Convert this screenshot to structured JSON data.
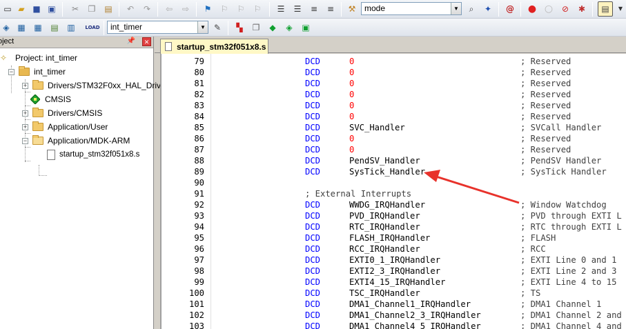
{
  "toolbar_top": {
    "icons": [
      "new-file-icon",
      "open-folder-icon",
      "save-icon",
      "save-all-icon",
      "cut-icon",
      "copy-icon",
      "paste-icon",
      "undo-icon",
      "redo-icon",
      "nav-back-icon",
      "nav-forward-icon",
      "bookmark-icon",
      "prev-bookmark-icon",
      "next-bookmark-icon",
      "clear-bookmarks-icon",
      "indent-icon",
      "unindent-icon",
      "comment-icon",
      "uncomment-icon",
      "find-in-files-icon"
    ],
    "find_combo_value": "mode",
    "icons_right": [
      "find-icon",
      "incremental-find-icon",
      "debug-session-icon",
      "breakpoint-icon",
      "disable-breakpoint-icon",
      "kill-breakpoints-icon",
      "kill-all-icon",
      "window-layout-icon"
    ]
  },
  "toolbar_second": {
    "icons": [
      "translate-icon",
      "build-icon",
      "rebuild-icon",
      "batch-build-icon",
      "download-icon"
    ],
    "load_label": "LOAD",
    "target_combo_value": "int_timer",
    "icons_right": [
      "target-options-icon",
      "manage-components-icon",
      "file-extensions-icon",
      "select-packs-icon",
      "pack-installer-icon",
      "runtime-env-icon"
    ]
  },
  "project_panel": {
    "title": "oject",
    "tree": [
      {
        "label": "Project: int_timer"
      },
      {
        "label": "int_timer"
      },
      {
        "label": "Drivers/STM32F0xx_HAL_Driv"
      },
      {
        "label": "CMSIS"
      },
      {
        "label": "Drivers/CMSIS"
      },
      {
        "label": "Application/User"
      },
      {
        "label": "Application/MDK-ARM"
      },
      {
        "label": "startup_stm32f051x8.s"
      }
    ]
  },
  "editor": {
    "active_tab": "startup_stm32f051x8.s",
    "lines": [
      {
        "n": "79",
        "kw": "DCD",
        "arg": "0",
        "num": true,
        "cmt": "; Reserved"
      },
      {
        "n": "80",
        "kw": "DCD",
        "arg": "0",
        "num": true,
        "cmt": "; Reserved"
      },
      {
        "n": "81",
        "kw": "DCD",
        "arg": "0",
        "num": true,
        "cmt": "; Reserved"
      },
      {
        "n": "82",
        "kw": "DCD",
        "arg": "0",
        "num": true,
        "cmt": "; Reserved"
      },
      {
        "n": "83",
        "kw": "DCD",
        "arg": "0",
        "num": true,
        "cmt": "; Reserved"
      },
      {
        "n": "84",
        "kw": "DCD",
        "arg": "0",
        "num": true,
        "cmt": "; Reserved"
      },
      {
        "n": "85",
        "kw": "DCD",
        "arg": "SVC_Handler",
        "num": false,
        "cmt": "; SVCall Handler"
      },
      {
        "n": "86",
        "kw": "DCD",
        "arg": "0",
        "num": true,
        "cmt": "; Reserved"
      },
      {
        "n": "87",
        "kw": "DCD",
        "arg": "0",
        "num": true,
        "cmt": "; Reserved"
      },
      {
        "n": "88",
        "kw": "DCD",
        "arg": "PendSV_Handler",
        "num": false,
        "cmt": "; PendSV Handler"
      },
      {
        "n": "89",
        "kw": "DCD",
        "arg": "SysTick_Handler",
        "num": false,
        "cmt": "; SysTick Handler"
      },
      {
        "n": "90",
        "kw": "",
        "arg": "",
        "num": false,
        "cmt": ""
      },
      {
        "n": "91",
        "full_comment": "; External Interrupts"
      },
      {
        "n": "92",
        "kw": "DCD",
        "arg": "WWDG_IRQHandler",
        "num": false,
        "cmt": "; Window Watchdog"
      },
      {
        "n": "93",
        "kw": "DCD",
        "arg": "PVD_IRQHandler",
        "num": false,
        "cmt": "; PVD through EXTI L"
      },
      {
        "n": "94",
        "kw": "DCD",
        "arg": "RTC_IRQHandler",
        "num": false,
        "cmt": "; RTC through EXTI L"
      },
      {
        "n": "95",
        "kw": "DCD",
        "arg": "FLASH_IRQHandler",
        "num": false,
        "cmt": "; FLASH"
      },
      {
        "n": "96",
        "kw": "DCD",
        "arg": "RCC_IRQHandler",
        "num": false,
        "cmt": "; RCC"
      },
      {
        "n": "97",
        "kw": "DCD",
        "arg": "EXTI0_1_IRQHandler",
        "num": false,
        "cmt": "; EXTI Line 0 and 1"
      },
      {
        "n": "98",
        "kw": "DCD",
        "arg": "EXTI2_3_IRQHandler",
        "num": false,
        "cmt": "; EXTI Line 2 and 3"
      },
      {
        "n": "99",
        "kw": "DCD",
        "arg": "EXTI4_15_IRQHandler",
        "num": false,
        "cmt": "; EXTI Line 4 to 15"
      },
      {
        "n": "100",
        "kw": "DCD",
        "arg": "TSC_IRQHandler",
        "num": false,
        "cmt": "; TS"
      },
      {
        "n": "101",
        "kw": "DCD",
        "arg": "DMA1_Channel1_IRQHandler",
        "num": false,
        "cmt": "; DMA1 Channel 1"
      },
      {
        "n": "102",
        "kw": "DCD",
        "arg": "DMA1_Channel2_3_IRQHandler",
        "num": false,
        "cmt": "; DMA1 Channel 2 and"
      },
      {
        "n": "103",
        "kw": "DCD",
        "arg": "DMA1_Channel4_5_IRQHandler",
        "num": false,
        "cmt": "; DMA1 Channel 4 and"
      }
    ]
  },
  "colors": {
    "keyword": "#0000ff",
    "number": "#ff0000",
    "annotation_arrow": "#e8322b"
  }
}
